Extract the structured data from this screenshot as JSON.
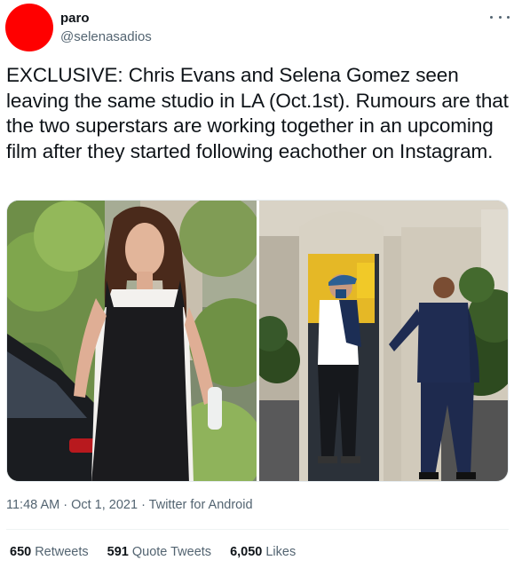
{
  "author": {
    "display_name": "paro",
    "handle": "@selenasadios",
    "avatar_color": "#ff0000"
  },
  "more_menu_icon": "more-horizontal-icon",
  "tweet": {
    "text": "EXCLUSIVE: Chris Evans and Selena Gomez seen leaving the same studio in LA (Oct.1st). Rumours are that the two superstars are working together in an upcoming film after they started following eachother on Instagram.",
    "timestamp": "11:48 AM · Oct 1, 2021 · Twitter for Android"
  },
  "stats": {
    "retweets_count": "650",
    "retweets_label": "Retweets",
    "quotes_count": "591",
    "quotes_label": "Quote Tweets",
    "likes_count": "6,050",
    "likes_label": "Likes"
  },
  "colors": {
    "text_primary": "#0f1419",
    "text_secondary": "#536471",
    "divider": "#eff3f4"
  }
}
